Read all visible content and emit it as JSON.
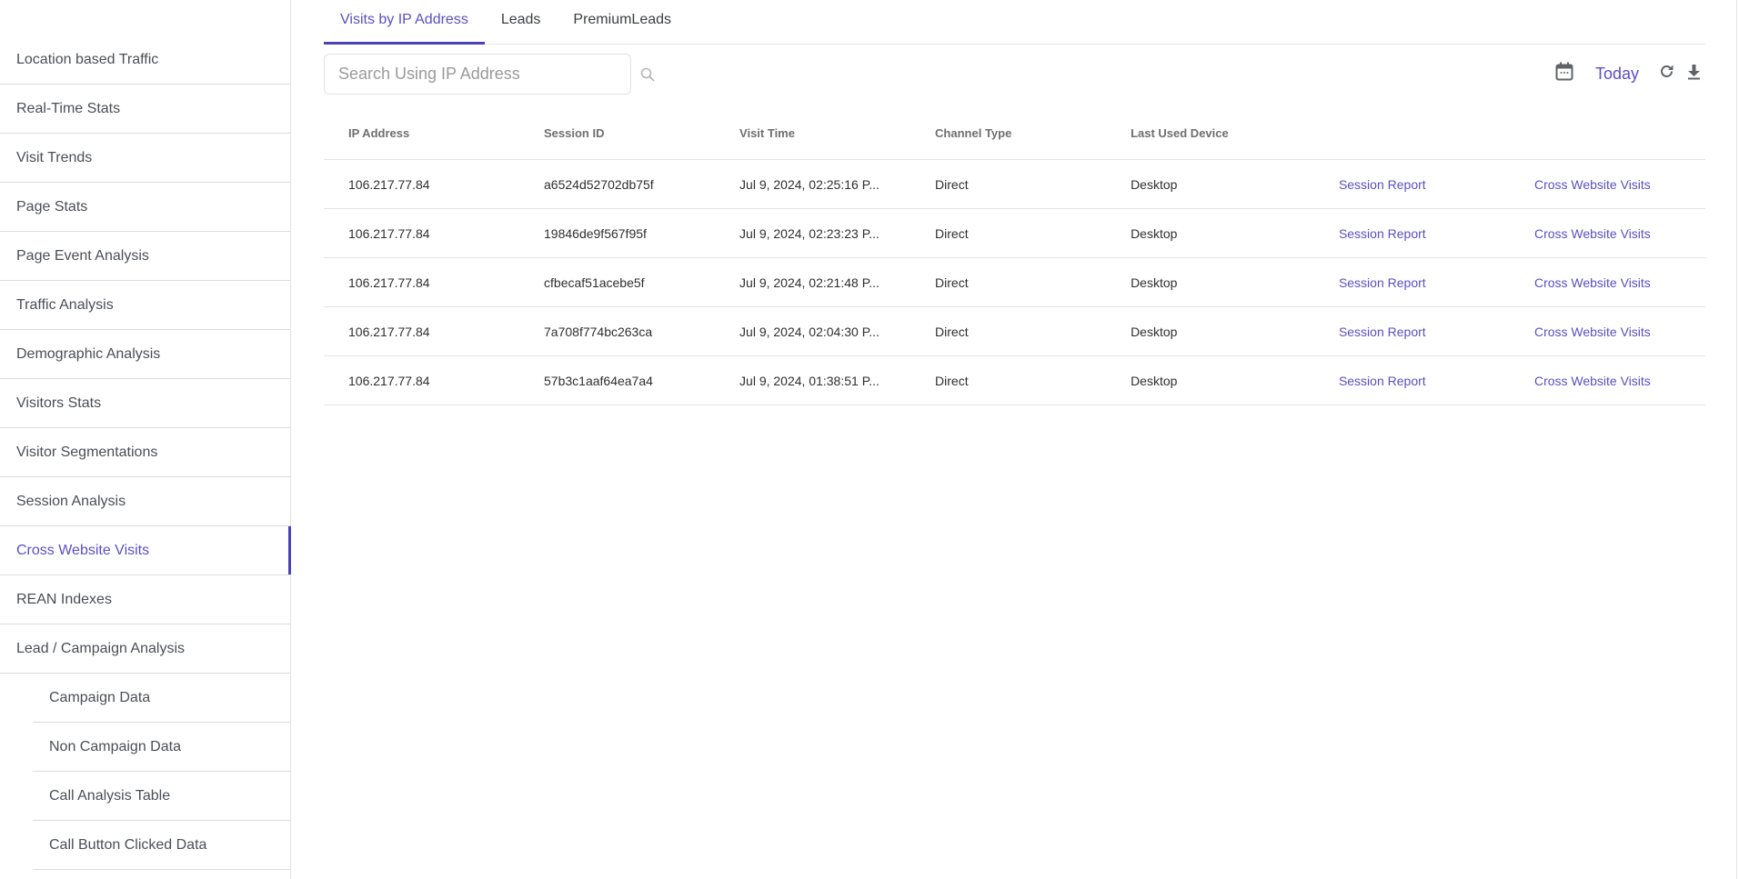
{
  "sidebar": {
    "items": [
      {
        "label": "Location based Traffic",
        "sub": false,
        "active": false
      },
      {
        "label": "Real-Time Stats",
        "sub": false,
        "active": false
      },
      {
        "label": "Visit Trends",
        "sub": false,
        "active": false
      },
      {
        "label": "Page Stats",
        "sub": false,
        "active": false
      },
      {
        "label": "Page Event Analysis",
        "sub": false,
        "active": false
      },
      {
        "label": "Traffic Analysis",
        "sub": false,
        "active": false
      },
      {
        "label": "Demographic Analysis",
        "sub": false,
        "active": false
      },
      {
        "label": "Visitors Stats",
        "sub": false,
        "active": false
      },
      {
        "label": "Visitor Segmentations",
        "sub": false,
        "active": false
      },
      {
        "label": "Session Analysis",
        "sub": false,
        "active": false
      },
      {
        "label": "Cross Website Visits",
        "sub": false,
        "active": true
      },
      {
        "label": "REAN Indexes",
        "sub": false,
        "active": false
      },
      {
        "label": "Lead / Campaign Analysis",
        "sub": false,
        "active": false
      },
      {
        "label": "Campaign Data",
        "sub": true,
        "active": false
      },
      {
        "label": "Non Campaign Data",
        "sub": true,
        "active": false
      },
      {
        "label": "Call Analysis Table",
        "sub": true,
        "active": false
      },
      {
        "label": "Call Button Clicked Data",
        "sub": true,
        "active": false
      }
    ]
  },
  "tabs": [
    {
      "label": "Visits by IP Address",
      "active": true
    },
    {
      "label": "Leads",
      "active": false
    },
    {
      "label": "PremiumLeads",
      "active": false
    }
  ],
  "search": {
    "placeholder": "Search Using IP Address",
    "value": "",
    "icon": "search-icon"
  },
  "toolbar": {
    "calendar_icon": "calendar-icon",
    "date_range_label": "Today",
    "refresh_icon": "refresh-icon",
    "download_icon": "download-icon"
  },
  "colors": {
    "accent": "#5b4fc4",
    "accent_bar": "#4b43b5",
    "text": "#3c4043",
    "header_text": "#6f6f6f",
    "divider": "#e4e4e4"
  },
  "table": {
    "columns": [
      "IP Address",
      "Session ID",
      "Visit Time",
      "Channel Type",
      "Last Used Device",
      "",
      ""
    ],
    "rows": [
      {
        "ip": "106.217.77.84",
        "session_id": "a6524d52702db75f",
        "visit_time": "Jul 9, 2024, 02:25:16 P...",
        "channel": "Direct",
        "device": "Desktop",
        "session_report": "Session Report",
        "cross_visits": "Cross Website Visits"
      },
      {
        "ip": "106.217.77.84",
        "session_id": "19846de9f567f95f",
        "visit_time": "Jul 9, 2024, 02:23:23 P...",
        "channel": "Direct",
        "device": "Desktop",
        "session_report": "Session Report",
        "cross_visits": "Cross Website Visits"
      },
      {
        "ip": "106.217.77.84",
        "session_id": "cfbecaf51acebe5f",
        "visit_time": "Jul 9, 2024, 02:21:48 P...",
        "channel": "Direct",
        "device": "Desktop",
        "session_report": "Session Report",
        "cross_visits": "Cross Website Visits"
      },
      {
        "ip": "106.217.77.84",
        "session_id": "7a708f774bc263ca",
        "visit_time": "Jul 9, 2024, 02:04:30 P...",
        "channel": "Direct",
        "device": "Desktop",
        "session_report": "Session Report",
        "cross_visits": "Cross Website Visits"
      },
      {
        "ip": "106.217.77.84",
        "session_id": "57b3c1aaf64ea7a4",
        "visit_time": "Jul 9, 2024, 01:38:51 P...",
        "channel": "Direct",
        "device": "Desktop",
        "session_report": "Session Report",
        "cross_visits": "Cross Website Visits"
      }
    ]
  }
}
